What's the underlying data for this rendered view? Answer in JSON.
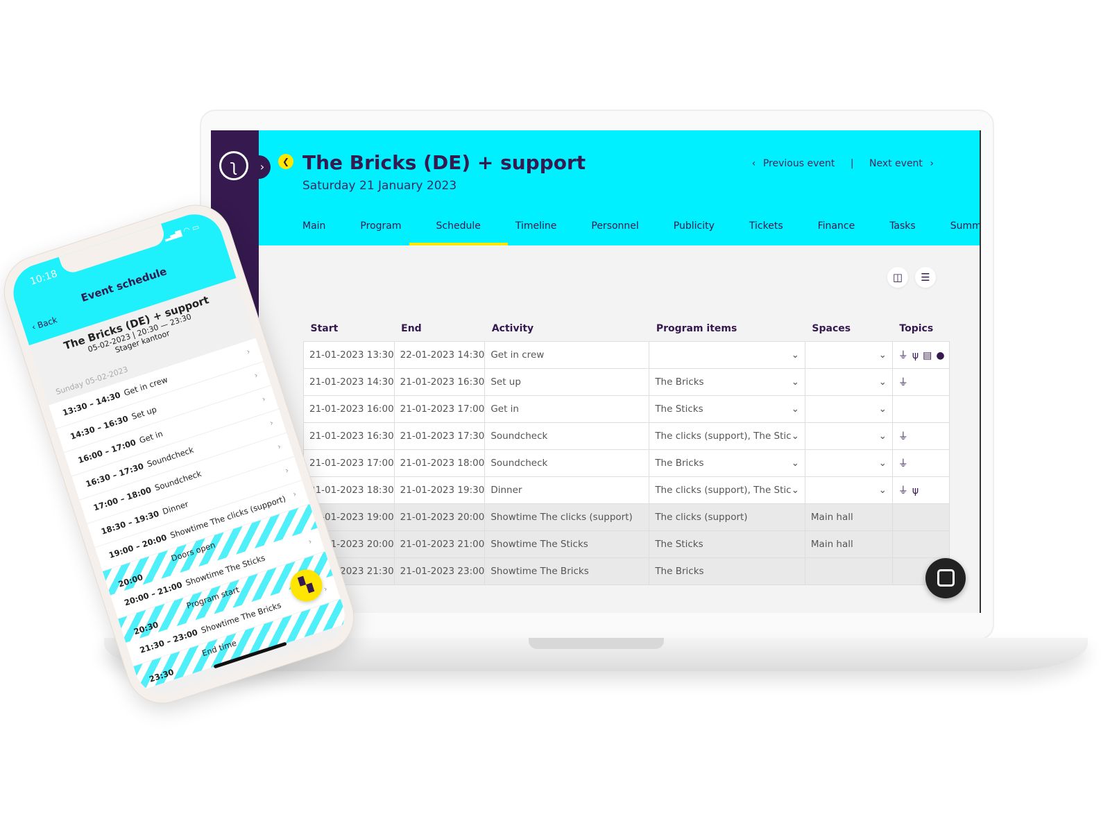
{
  "colors": {
    "accent": "#00f0ff",
    "sidebar": "#35194f",
    "highlight": "#ffe600"
  },
  "header": {
    "title": "The Bricks (DE) + support",
    "date": "Saturday 21 January 2023",
    "prev": "Previous event",
    "next": "Next event",
    "sep": "|"
  },
  "tabs": [
    {
      "label": "Main"
    },
    {
      "label": "Program"
    },
    {
      "label": "Schedule",
      "active": true
    },
    {
      "label": "Timeline"
    },
    {
      "label": "Personnel"
    },
    {
      "label": "Publicity"
    },
    {
      "label": "Tickets"
    },
    {
      "label": "Finance"
    },
    {
      "label": "Tasks"
    },
    {
      "label": "Summary"
    }
  ],
  "toolbar": {
    "icons": [
      "columns-icon",
      "sliders-icon"
    ]
  },
  "table": {
    "columns": [
      "Start",
      "End",
      "Activity",
      "Program items",
      "Spaces",
      "Topics"
    ],
    "rows": [
      {
        "start": "21-01-2023 13:30",
        "end": "22-01-2023 14:30",
        "activity": "Get in crew",
        "program": "",
        "spaces": "",
        "topics": [
          "plug-icon",
          "utensils-icon",
          "clipboard-icon",
          "user-icon"
        ],
        "editable": true
      },
      {
        "start": "21-01-2023 14:30",
        "end": "21-01-2023 16:30",
        "activity": "Set up",
        "program": "The Bricks",
        "spaces": "",
        "topics": [
          "plug-icon"
        ],
        "editable": true
      },
      {
        "start": "21-01-2023 16:00",
        "end": "21-01-2023 17:00",
        "activity": "Get in",
        "program": "The Sticks",
        "spaces": "",
        "topics": [],
        "editable": true
      },
      {
        "start": "21-01-2023 16:30",
        "end": "21-01-2023 17:30",
        "activity": "Soundcheck",
        "program": "The clicks (support), The Stic",
        "spaces": "",
        "topics": [
          "plug-icon"
        ],
        "editable": true
      },
      {
        "start": "21-01-2023 17:00",
        "end": "21-01-2023 18:00",
        "activity": "Soundcheck",
        "program": "The Bricks",
        "spaces": "",
        "topics": [
          "plug-icon"
        ],
        "editable": true
      },
      {
        "start": "21-01-2023 18:30",
        "end": "21-01-2023 19:30",
        "activity": "Dinner",
        "program": "The clicks (support), The Stic",
        "spaces": "",
        "topics": [
          "plug-icon",
          "utensils-icon"
        ],
        "editable": true
      },
      {
        "start": "21-01-2023 19:00",
        "end": "21-01-2023 20:00",
        "activity": "Showtime The clicks (support)",
        "program": "The clicks (support)",
        "spaces": "Main hall",
        "topics": [],
        "editable": false
      },
      {
        "start": "21-01-2023 20:00",
        "end": "21-01-2023 21:00",
        "activity": "Showtime The Sticks",
        "program": "The Sticks",
        "spaces": "Main hall",
        "topics": [],
        "editable": false
      },
      {
        "start": "21-01-2023 21:30",
        "end": "21-01-2023 23:00",
        "activity": "Showtime The Bricks",
        "program": "The Bricks",
        "spaces": "",
        "topics": [],
        "editable": false
      }
    ]
  },
  "phone": {
    "time": "10:18",
    "back": "Back",
    "title": "Event schedule",
    "event": "The Bricks (DE) + support",
    "when": "05-02-2023 | 20:30 — 23:30",
    "venue": "Stager kantoor",
    "day": "Sunday 05-02-2023",
    "items": [
      {
        "time": "13:30 – 14:30",
        "label": "Get in crew"
      },
      {
        "time": "14:30 – 16:30",
        "label": "Set up"
      },
      {
        "time": "16:00 – 17:00",
        "label": "Get in"
      },
      {
        "time": "16:30 – 17:30",
        "label": "Soundcheck"
      },
      {
        "time": "17:00 – 18:00",
        "label": "Soundcheck"
      },
      {
        "time": "18:30 – 19:30",
        "label": "Dinner"
      },
      {
        "time": "19:00 – 20:00",
        "label": "Showtime The clicks (support)"
      },
      {
        "time": "20:00",
        "label": "Doors open",
        "marker": true
      },
      {
        "time": "20:00 – 21:00",
        "label": "Showtime The Sticks"
      },
      {
        "time": "20:30",
        "label": "Program start",
        "marker": true
      },
      {
        "time": "21:30 – 23:00",
        "label": "Showtime The Bricks"
      },
      {
        "time": "23:30",
        "label": "End time",
        "marker": true
      }
    ]
  }
}
